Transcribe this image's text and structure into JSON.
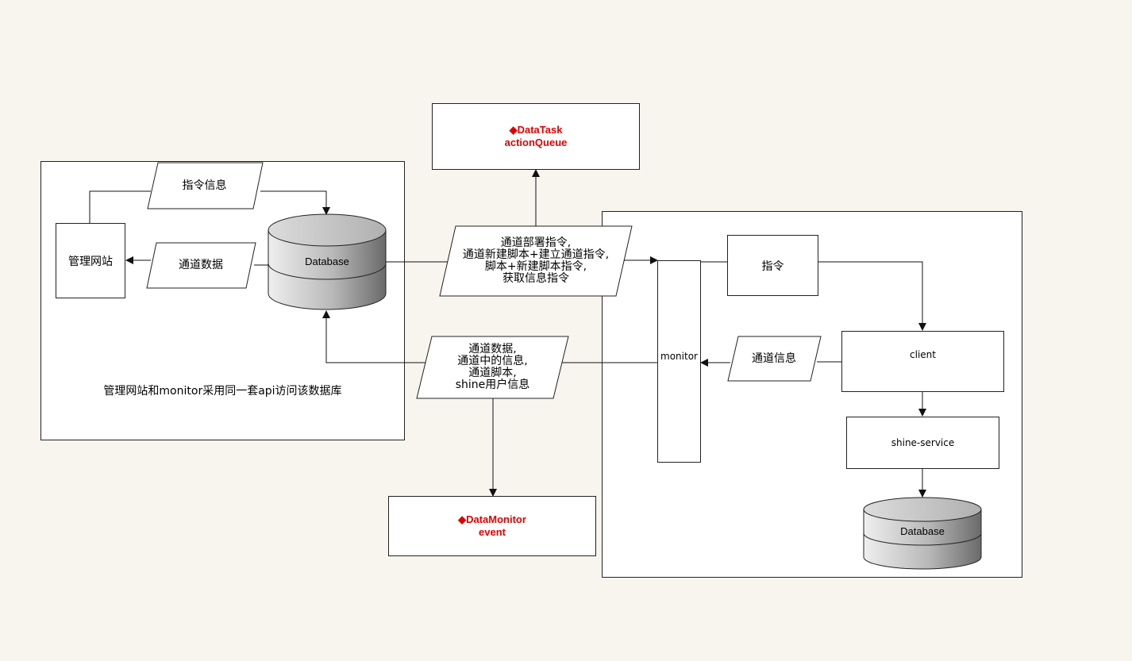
{
  "datatask": {
    "line1": "◆DataTask",
    "line2": "actionQueue"
  },
  "datamonitor": {
    "line1": "◆DataMonitor",
    "line2": "event"
  },
  "left_group": {
    "website": "管理网站",
    "cmd_info": "指令信息",
    "channel_data": "通道数据",
    "database": "Database",
    "note": "管理网站和monitor采用同一套api访问该数据库"
  },
  "upper_para": "通道部署指令,\n通道新建脚本+建立通道指令,\n脚本+新建脚本指令,\n获取信息指令",
  "lower_para": "通道数据,\n通道中的信息,\n通道脚本,\nshine用户信息",
  "right_group": {
    "monitor": "monitor",
    "command": "指令",
    "client": "client",
    "channel_info": "通道信息",
    "shine_service": "shine-service",
    "database": "Database"
  }
}
